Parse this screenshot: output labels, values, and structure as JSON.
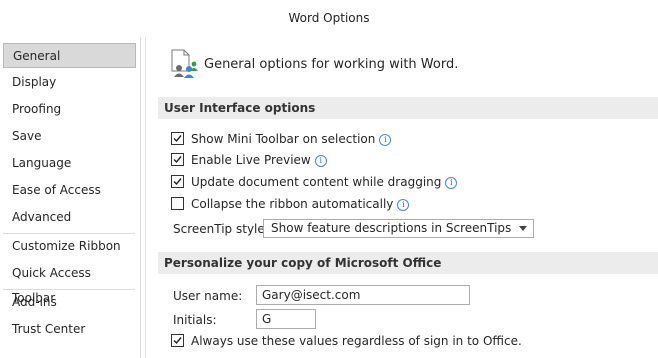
{
  "window": {
    "title": "Word Options"
  },
  "sidebar": {
    "items": [
      {
        "label": "General",
        "selected": true
      },
      {
        "label": "Display"
      },
      {
        "label": "Proofing"
      },
      {
        "label": "Save"
      },
      {
        "label": "Language"
      },
      {
        "label": "Ease of Access"
      },
      {
        "label": "Advanced"
      },
      {
        "label": "Customize Ribbon"
      },
      {
        "label": "Quick Access Toolbar"
      },
      {
        "label": "Add-ins"
      },
      {
        "label": "Trust Center"
      }
    ]
  },
  "main": {
    "header": {
      "text": "General options for working with Word.",
      "icon": "people-settings-icon"
    },
    "ui_section": {
      "title": "User Interface options",
      "options": [
        {
          "label": "Show Mini Toolbar on selection",
          "checked": true,
          "info": true
        },
        {
          "label": "Enable Live Preview",
          "checked": true,
          "info": true
        },
        {
          "label": "Update document content while dragging",
          "checked": true,
          "info": true
        },
        {
          "label": "Collapse the ribbon automatically",
          "checked": false,
          "info": true
        }
      ],
      "screentip": {
        "label": "ScreenTip style:",
        "value": "Show feature descriptions in ScreenTips"
      }
    },
    "personalize_section": {
      "title": "Personalize your copy of Microsoft Office",
      "username": {
        "label": "User name:",
        "value": "Gary@isect.com"
      },
      "initials": {
        "label": "Initials:",
        "value": "G"
      },
      "always_use": {
        "label": "Always use these values regardless of sign in to Office.",
        "checked": true
      }
    }
  },
  "colors": {
    "selected_bg": "#d9d9d9",
    "section_bg": "#ececec",
    "info_blue": "#2f6db5"
  }
}
